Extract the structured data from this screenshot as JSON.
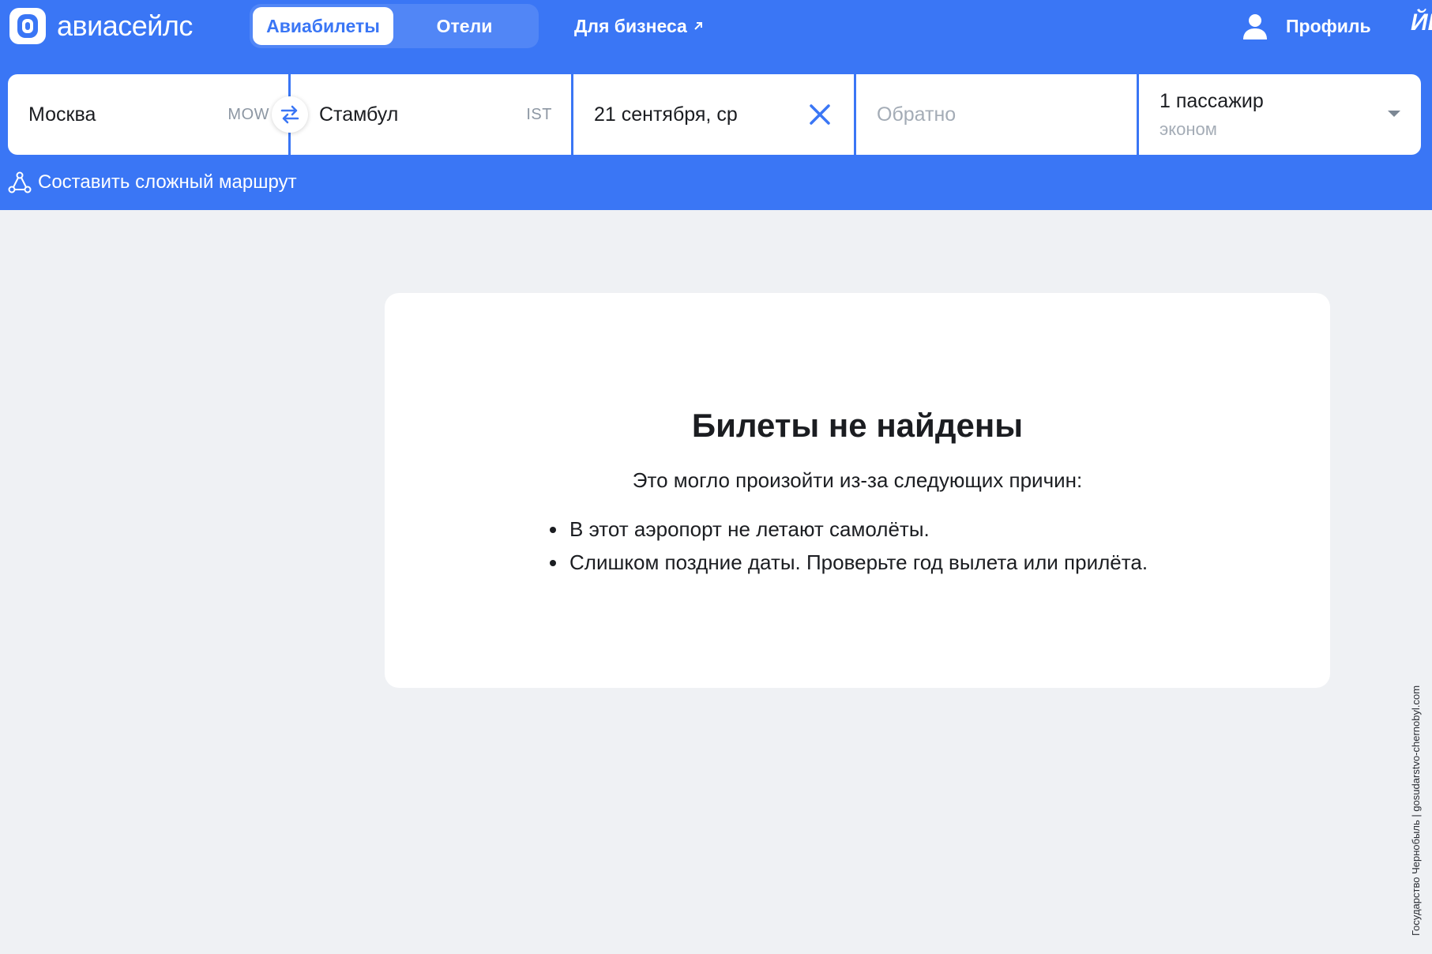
{
  "header": {
    "logo_text": "авиасейлс",
    "tabs": [
      {
        "label": "Авиабилеты",
        "active": true
      },
      {
        "label": "Отели",
        "active": false
      }
    ],
    "business_link": "Для бизнеса",
    "profile_label": "Профиль",
    "brand_color": "#3a76f5"
  },
  "search": {
    "origin": {
      "city": "Москва",
      "code": "MOW"
    },
    "destination": {
      "city": "Стамбул",
      "code": "IST"
    },
    "depart_date": "21 сентября, ср",
    "return_placeholder": "Обратно",
    "passengers": {
      "count_label": "1 пассажир",
      "class_label": "эконом"
    },
    "complex_route_label": "Составить сложный маршрут"
  },
  "result": {
    "title": "Билеты не найдены",
    "subtitle": "Это могло произойти из-за следующих причин:",
    "reasons": [
      "В этот аэропорт не летают самолёты.",
      "Слишком поздние даты. Проверьте год вылета или прилёта."
    ]
  },
  "watermark": "Государство Чернобыль | gosudarstvo-chernobyl.com"
}
